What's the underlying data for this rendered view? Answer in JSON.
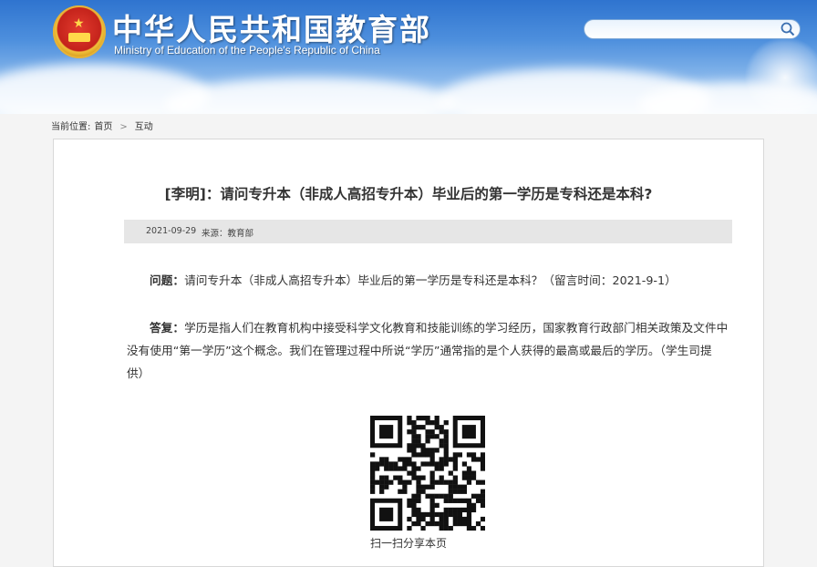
{
  "header": {
    "site_title": "中华人民共和国教育部",
    "site_subtitle": "Ministry of Education of the People's Republic of China",
    "search": {
      "placeholder": "",
      "icon": "search-icon"
    },
    "emblem_icon": "national-emblem"
  },
  "breadcrumb": {
    "prefix": "当前位置:",
    "items": [
      "首页",
      "互动"
    ],
    "separator": ">"
  },
  "article": {
    "title": "[李明]：请问专升本（非成人高招专升本）毕业后的第一学历是专科还是本科?",
    "date": "2021-09-29",
    "source": "来源：教育部",
    "question_label": "问题：",
    "question_text": "请问专升本（非成人高招专升本）毕业后的第一学历是专科还是本科？（留言时间：2021-9-1）",
    "answer_label": "答复：",
    "answer_text": "学历是指人们在教育机构中接受科学文化教育和技能训练的学习经历，国家教育行政部门相关政策及文件中没有使用“第一学历”这个概念。我们在管理过程中所说“学历”通常指的是个人获得的最高或最后的学历。（学生司提供）",
    "qr_caption": "扫一扫分享本页"
  },
  "colors": {
    "header_blue": "#2f74cf",
    "meta_bar": "#e6e6e6",
    "text": "#333333"
  }
}
